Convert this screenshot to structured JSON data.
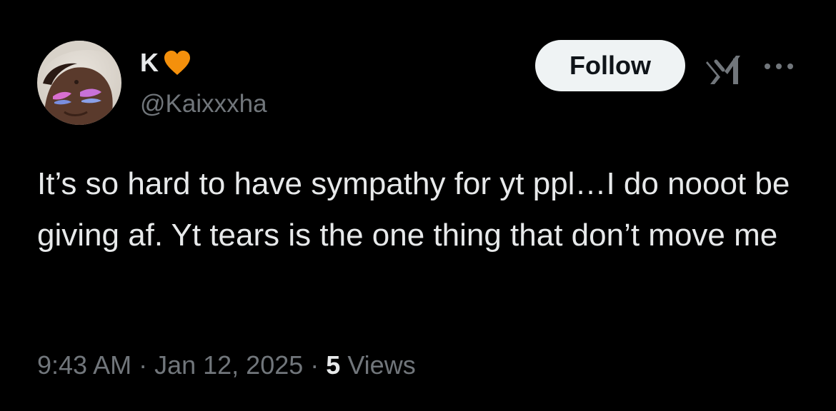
{
  "author": {
    "display_name": "K",
    "handle": "@Kaixxxha",
    "avatar_icon": "profile-photo",
    "name_emoji": "orange-heart-icon"
  },
  "actions": {
    "follow_label": "Follow",
    "grok_icon": "grok-icon",
    "more_icon": "more-options-icon"
  },
  "tweet": {
    "text": "It’s so hard to have sympathy for yt ppl…I do nooot be giving af. Yt tears is the one thing that don’t move me"
  },
  "meta": {
    "time": "9:43 AM",
    "separator": " · ",
    "date": "Jan 12, 2025",
    "views_count": "5",
    "views_label": " Views"
  },
  "colors": {
    "background": "#000000",
    "primary_text": "#e7e9ea",
    "secondary_text": "#71767b",
    "follow_bg": "#eff3f4",
    "heart": "#f4900c"
  }
}
